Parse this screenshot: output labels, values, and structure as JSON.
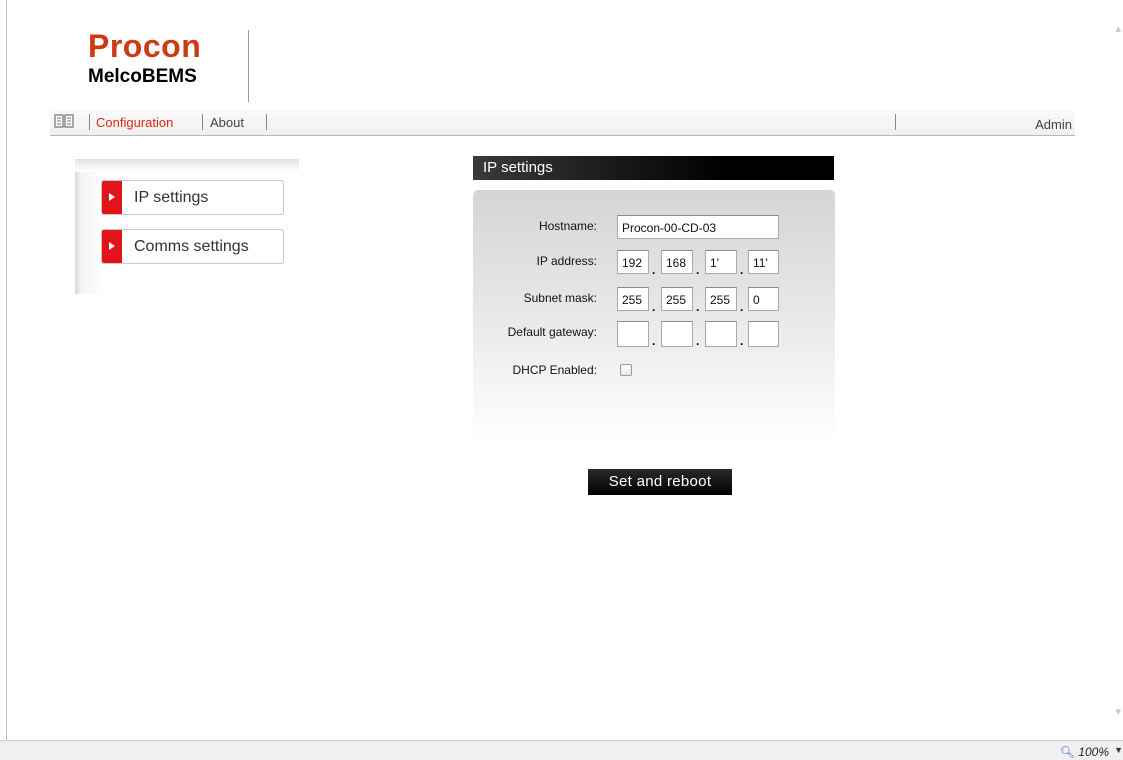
{
  "logo": {
    "brand": "Procon",
    "product": "MelcoBEMS"
  },
  "nav": {
    "book_icon": "book-icon",
    "items": [
      {
        "label": "Configuration",
        "active": true
      },
      {
        "label": "About",
        "active": false
      }
    ],
    "user": "Admin"
  },
  "sidebar": {
    "items": [
      {
        "label": "IP settings"
      },
      {
        "label": "Comms settings"
      }
    ]
  },
  "section": {
    "title": "IP settings"
  },
  "form": {
    "hostname_label": "Hostname:",
    "hostname_value": "Procon-00-CD-03",
    "ip_label": "IP address:",
    "ip_octets": [
      "192",
      "168",
      "1'",
      "11'"
    ],
    "subnet_label": "Subnet mask:",
    "subnet_octets": [
      "255",
      "255",
      "255",
      "0"
    ],
    "gateway_label": "Default gateway:",
    "gateway_octets": [
      "",
      "",
      "",
      ""
    ],
    "dhcp_label": "DHCP Enabled:",
    "dhcp_checked": false
  },
  "actions": {
    "submit_label": "Set and reboot"
  },
  "status": {
    "zoom": "100%"
  },
  "colors": {
    "brand": "#cc3b14",
    "accent": "#e0141a",
    "active_nav": "#d62b14"
  }
}
